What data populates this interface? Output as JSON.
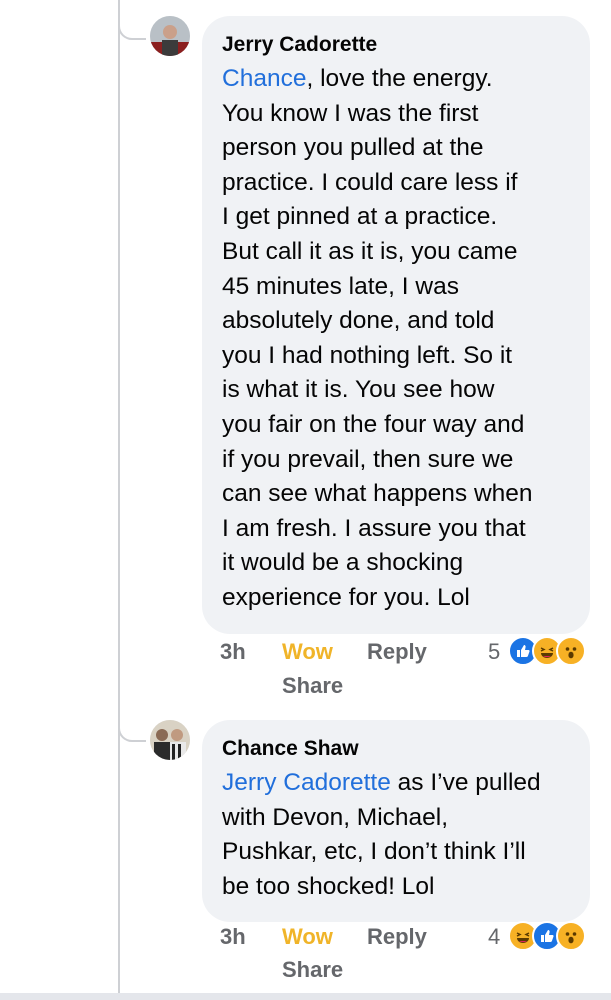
{
  "comments": [
    {
      "author": "Jerry Cadorette",
      "mention": "Chance",
      "body": ", love the energy.\nYou know I was the first\nperson you pulled at the\npractice.  I could care less if\nI get pinned at a practice.\nBut call it as it is, you came\n45 minutes late, I was\nabsolutely done, and told\nyou I had nothing left.  So it\nis what it is.  You see how\nyou fair on the four way and\nif you prevail, then sure we\ncan see what happens when\nI am fresh.  I assure you that\nit would be a shocking\nexperience for you. Lol",
      "time": "3h",
      "reaction_label": "Wow",
      "reply_label": "Reply",
      "share_label": "Share",
      "reaction_count": "5",
      "reaction_icons": [
        "like-icon",
        "haha-icon",
        "wow-icon"
      ]
    },
    {
      "author": "Chance Shaw",
      "mention": "Jerry Cadorette",
      "body": " as I’ve pulled\nwith Devon, Michael,\nPushkar, etc, I don’t think I’ll\nbe too shocked! Lol",
      "time": "3h",
      "reaction_label": "Wow",
      "reply_label": "Reply",
      "share_label": "Share",
      "reaction_count": "4",
      "reaction_icons": [
        "haha-icon",
        "like-icon",
        "wow-icon"
      ]
    }
  ],
  "colors": {
    "mention": "#216fdb",
    "wow_label": "#f0b429",
    "bubble": "#f0f2f5",
    "meta": "#65676b"
  }
}
